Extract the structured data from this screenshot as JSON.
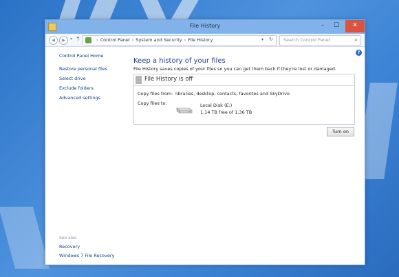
{
  "window": {
    "title": "File History",
    "controls": {
      "minimize": "–",
      "maximize": "☐",
      "close": "✕"
    }
  },
  "nav": {
    "back_icon": "back-arrow-icon",
    "forward_icon": "forward-arrow-icon",
    "up_icon": "up-arrow-icon",
    "breadcrumbs": [
      "Control Panel",
      "System and Security",
      "File History"
    ],
    "search_placeholder": "Search Control Panel"
  },
  "sidebar": {
    "home": "Control Panel Home",
    "links": [
      "Restore personal files",
      "Select drive",
      "Exclude folders",
      "Advanced settings"
    ],
    "see_also_label": "See also",
    "see_also_links": [
      "Recovery",
      "Windows 7 File Recovery"
    ]
  },
  "main": {
    "title": "Keep a history of your files",
    "description": "File History saves copies of your files so you can get them back if they're lost or damaged.",
    "status": "File History is off",
    "copy_from_label": "Copy files from:",
    "copy_from_value": "libraries, desktop, contacts, favorites and SkyDrive",
    "copy_to_label": "Copy files to:",
    "disk_name": "Local Disk (E:)",
    "disk_free": "1.14 TB free of 1.36 TB",
    "turn_on_button": "Turn on"
  },
  "colors": {
    "desktop": "#3b82d4",
    "titlebar": "#82b2ea",
    "close_button": "#d9533e",
    "link": "#0b3e7a",
    "heading": "#1e3a8a"
  }
}
